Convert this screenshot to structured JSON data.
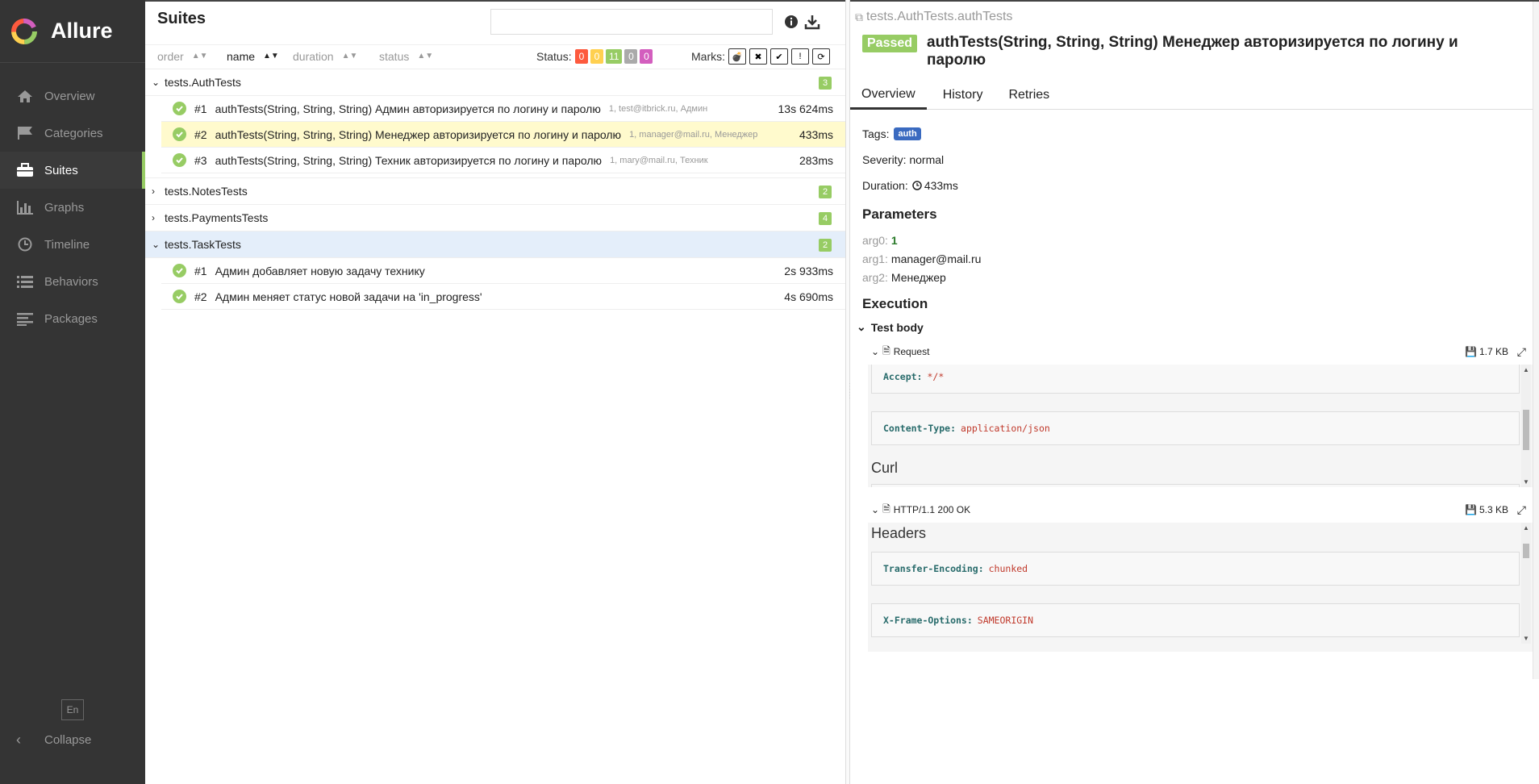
{
  "sidebar": {
    "brand": "Allure",
    "items": [
      {
        "label": "Overview",
        "icon": "home-icon",
        "active": false
      },
      {
        "label": "Categories",
        "icon": "flag-icon",
        "active": false
      },
      {
        "label": "Suites",
        "icon": "briefcase-icon",
        "active": true
      },
      {
        "label": "Graphs",
        "icon": "bar-chart-icon",
        "active": false
      },
      {
        "label": "Timeline",
        "icon": "clock-icon",
        "active": false
      },
      {
        "label": "Behaviors",
        "icon": "list-icon",
        "active": false
      },
      {
        "label": "Packages",
        "icon": "align-left-icon",
        "active": false
      }
    ],
    "lang": "En",
    "collapse": "Collapse"
  },
  "suites": {
    "title": "Suites",
    "search_value": "",
    "sorters": [
      {
        "label": "order"
      },
      {
        "label": "name"
      },
      {
        "label": "duration"
      },
      {
        "label": "status"
      }
    ],
    "status_label": "Status:",
    "status_badges": [
      {
        "value": "0",
        "color": "#fd5a3e"
      },
      {
        "value": "0",
        "color": "#ffd050"
      },
      {
        "value": "11",
        "color": "#97cc64"
      },
      {
        "value": "0",
        "color": "#aaaaaa"
      },
      {
        "value": "0",
        "color": "#d35ebe"
      }
    ],
    "marks_label": "Marks:",
    "groups": [
      {
        "name": "tests.AuthTests",
        "count": "3",
        "expanded": true,
        "tests": [
          {
            "num": "#1",
            "name": "authTests(String, String, String) Админ авторизируется по логину и паролю",
            "params": "1, test@itbrick.ru, Админ",
            "duration": "13s 624ms"
          },
          {
            "num": "#2",
            "name": "authTests(String, String, String) Менеджер авторизируется по логину и паролю",
            "params": "1, manager@mail.ru, Менеджер",
            "duration": "433ms"
          },
          {
            "num": "#3",
            "name": "authTests(String, String, String) Техник авторизируется по логину и паролю",
            "params": "1, mary@mail.ru, Техник",
            "duration": "283ms"
          }
        ]
      },
      {
        "name": "tests.NotesTests",
        "count": "2",
        "expanded": false,
        "tests": []
      },
      {
        "name": "tests.PaymentsTests",
        "count": "4",
        "expanded": false,
        "tests": []
      },
      {
        "name": "tests.TaskTests",
        "count": "2",
        "expanded": true,
        "tests": [
          {
            "num": "#1",
            "name": "Админ добавляет новую задачу технику",
            "params": "",
            "duration": "2s 933ms"
          },
          {
            "num": "#2",
            "name": "Админ меняет статус новой задачи на 'in_progress'",
            "params": "",
            "duration": "4s 690ms"
          }
        ]
      }
    ]
  },
  "detail": {
    "path": "tests.AuthTests.authTests",
    "status": "Passed",
    "title": "authTests(String, String, String) Менеджер авторизируется по логину и паролю",
    "tabs": [
      "Overview",
      "History",
      "Retries"
    ],
    "tags_label": "Tags:",
    "tag": "auth",
    "severity": "Severity: normal",
    "duration_label": "Duration:",
    "duration": "433ms",
    "parameters_title": "Parameters",
    "params": [
      {
        "key": "arg0:",
        "value": "1"
      },
      {
        "key": "arg1:",
        "value": "manager@mail.ru"
      },
      {
        "key": "arg2:",
        "value": "Менеджер"
      }
    ],
    "execution_title": "Execution",
    "step": "Test body",
    "attachments": {
      "request": {
        "name": "Request",
        "size": "1.7 KB",
        "headers": [
          {
            "key": "Accept:",
            "value": "*/*"
          },
          {
            "key": "Content-Type:",
            "value": "application/json"
          }
        ],
        "section": "Curl"
      },
      "response": {
        "name": "HTTP/1.1 200 OK",
        "size": "5.3 KB",
        "section": "Headers",
        "headers": [
          {
            "key": "Transfer-Encoding:",
            "value": "chunked"
          },
          {
            "key": "X-Frame-Options:",
            "value": "SAMEORIGIN"
          }
        ]
      }
    }
  }
}
